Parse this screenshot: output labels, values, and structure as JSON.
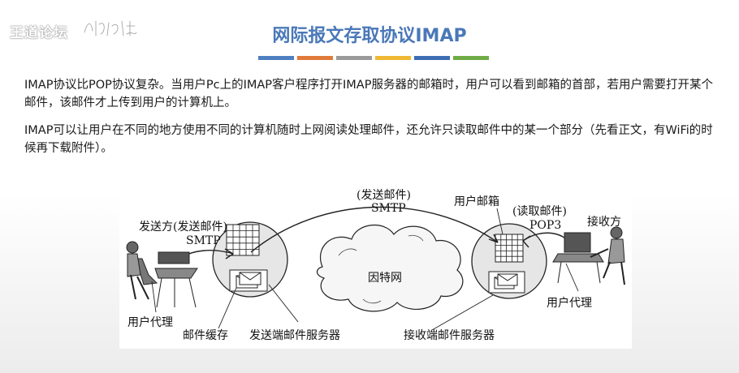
{
  "brand": {
    "logo_text": "王道论坛"
  },
  "slide": {
    "title": "网际报文存取协议IMAP",
    "accent_colors": [
      "#4e7fc1",
      "#e07a3a",
      "#9a9a9a",
      "#f0b832",
      "#3d6db4",
      "#6fac46"
    ],
    "paragraphs": [
      "IMAP协议比POP协议复杂。当用户Pc上的IMAP客户程序打开IMAP服务器的邮箱时，用户可以看到邮箱的首部，若用户需要打开某个邮件，该邮件才上传到用户的计算机上。",
      "IMAP可以让用户在不同的地方使用不同的计算机随时上网阅读处理邮件，还允许只读取邮件中的某一个部分（先看正文，有WiFi的时候再下载附件）。"
    ]
  },
  "diagram": {
    "sender_label": "发送方(发送邮件)",
    "smtp_left": "SMTP",
    "send_mail_label": "(发送邮件)",
    "smtp_top": "SMTP",
    "mailbox_label": "用户邮箱",
    "read_mail_label": "(读取邮件)",
    "pop3_label": "POP3",
    "receiver_label": "接收方",
    "internet_label": "因特网",
    "user_agent_left": "用户代理",
    "mail_cache": "邮件缓存",
    "send_server": "发送端邮件服务器",
    "recv_server": "接收端邮件服务器",
    "user_agent_right": "用户代理"
  }
}
